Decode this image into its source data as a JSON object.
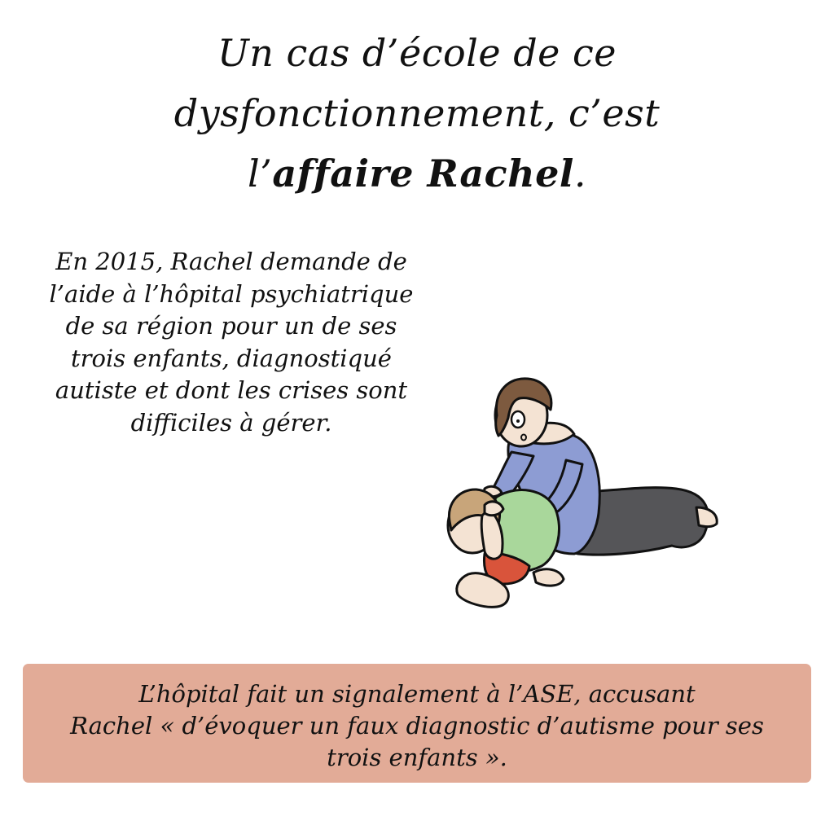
{
  "title": {
    "line1": "Un cas d’école de ce",
    "line2": "dysfonctionnement, c’est",
    "line3_prefix": "l’",
    "line3_bold": "affaire Rachel",
    "line3_suffix": "."
  },
  "narration": {
    "lines": [
      "En 2015, Rachel demande de",
      "l’aide à l’hôpital psychiatrique",
      "de sa région pour un de ses",
      "trois enfants, diagnostiqué",
      "autiste et dont les crises sont",
      "difficiles à gérer."
    ]
  },
  "caption": {
    "lines": [
      "L’hôpital fait un signalement à l’ASE, accusant",
      "Rachel « d’évoquer un faux diagnostic d’autisme pour ses",
      "trois enfants »."
    ]
  },
  "colors": {
    "caption_background": "#e2ab97",
    "mother_sweater": "#8d9cd3",
    "mother_pants": "#555558",
    "mother_hair": "#7d5a3f",
    "skin": "#f4e3d3",
    "child_shirt": "#a9d79b",
    "child_shorts": "#d9543b",
    "child_hair": "#c8a57a"
  },
  "illustration": {
    "subject": "mother-comforting-child"
  }
}
